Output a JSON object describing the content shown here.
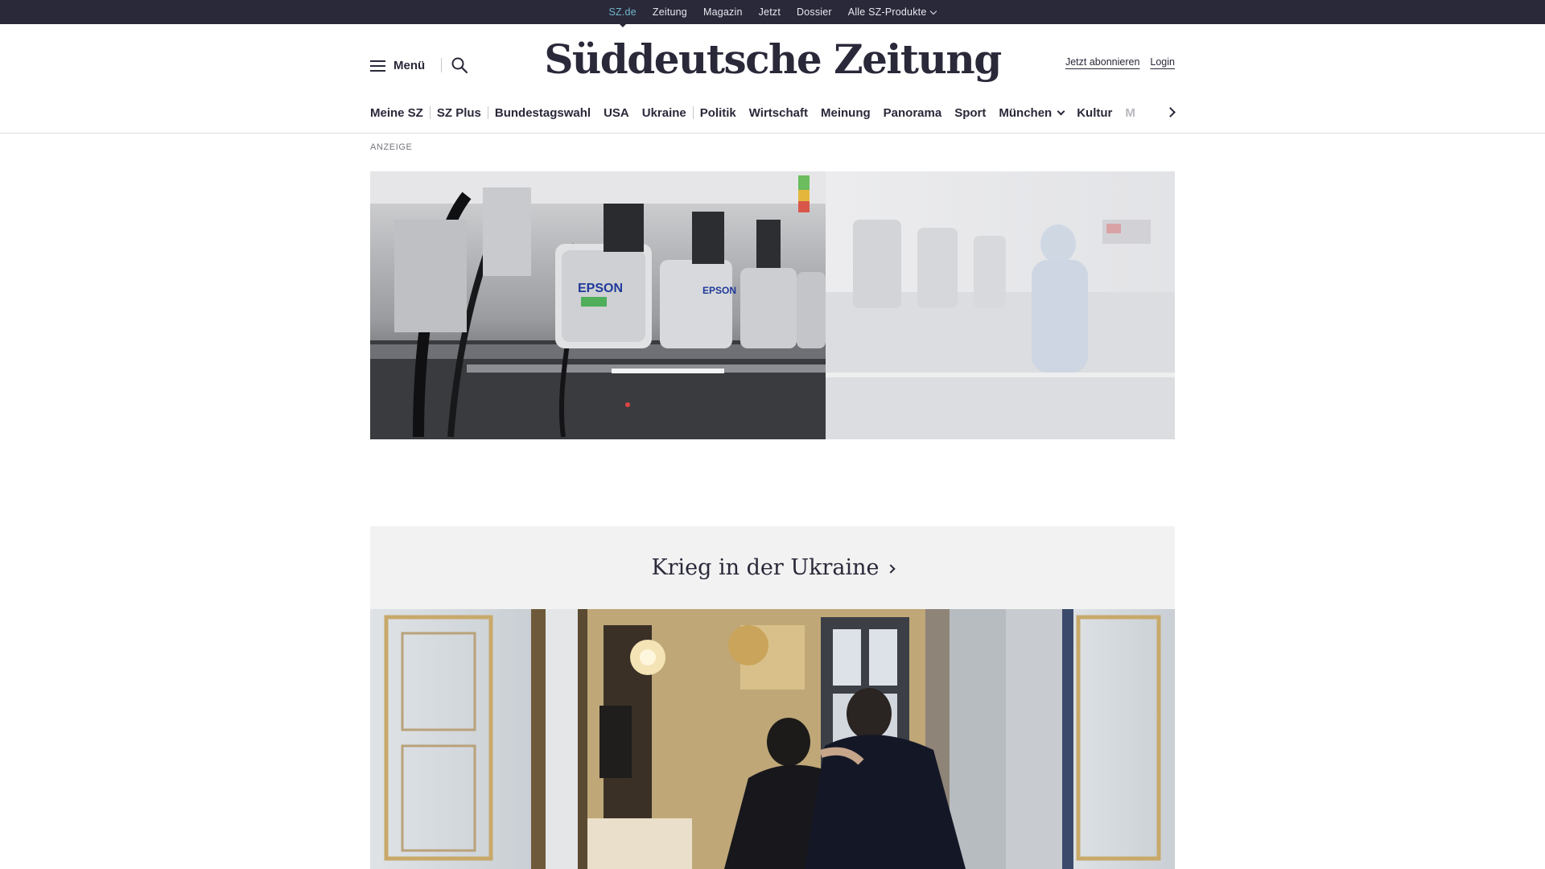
{
  "topbar": {
    "links": [
      {
        "label": "SZ.de",
        "active": true
      },
      {
        "label": "Zeitung"
      },
      {
        "label": "Magazin"
      },
      {
        "label": "Jetzt"
      },
      {
        "label": "Dossier"
      },
      {
        "label": "Alle SZ-Produkte",
        "dropdown": true
      }
    ]
  },
  "masthead": {
    "menu_label": "Menü",
    "logo_text": "Süddeutsche Zeitung",
    "subscribe_label": "Jetzt abonnieren",
    "login_label": "Login"
  },
  "nav": {
    "items": [
      "Meine SZ",
      "SZ Plus",
      "Bundestagswahl",
      "USA",
      "Ukraine",
      "Politik",
      "Wirtschaft",
      "Meinung",
      "Panorama",
      "Sport",
      "München",
      "Kultur",
      "M"
    ]
  },
  "ad": {
    "label": "ANZEIGE",
    "brand_text": "EPSON"
  },
  "section": {
    "title": "Krieg in der Ukraine"
  },
  "colors": {
    "topbar_bg": "#29293a",
    "active_link": "#71b6c9",
    "text": "#29293a",
    "section_bg": "#f2f2f2"
  }
}
